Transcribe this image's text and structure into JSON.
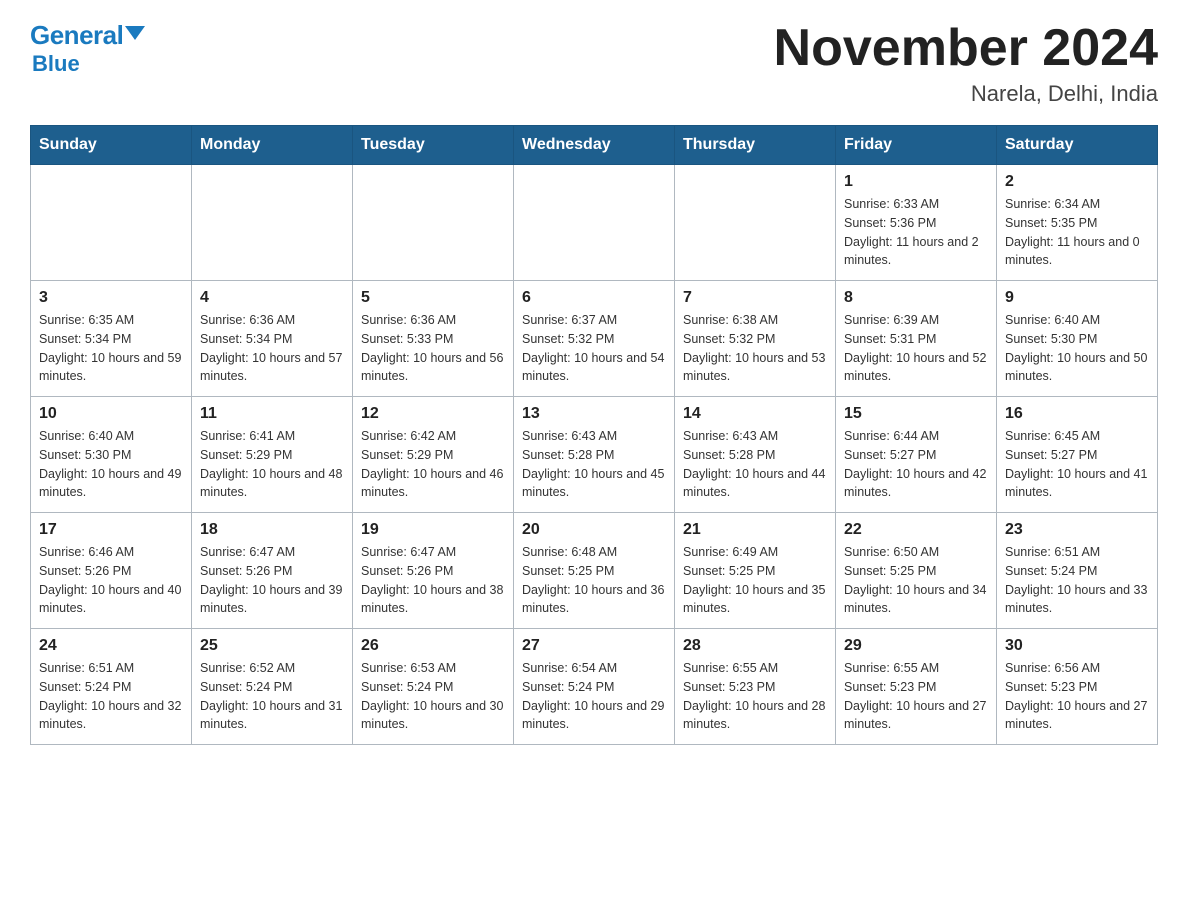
{
  "header": {
    "logo_general": "General",
    "logo_blue": "Blue",
    "month_title": "November 2024",
    "location": "Narela, Delhi, India"
  },
  "weekdays": [
    "Sunday",
    "Monday",
    "Tuesday",
    "Wednesday",
    "Thursday",
    "Friday",
    "Saturday"
  ],
  "weeks": [
    [
      {
        "day": "",
        "info": ""
      },
      {
        "day": "",
        "info": ""
      },
      {
        "day": "",
        "info": ""
      },
      {
        "day": "",
        "info": ""
      },
      {
        "day": "",
        "info": ""
      },
      {
        "day": "1",
        "info": "Sunrise: 6:33 AM\nSunset: 5:36 PM\nDaylight: 11 hours and 2 minutes."
      },
      {
        "day": "2",
        "info": "Sunrise: 6:34 AM\nSunset: 5:35 PM\nDaylight: 11 hours and 0 minutes."
      }
    ],
    [
      {
        "day": "3",
        "info": "Sunrise: 6:35 AM\nSunset: 5:34 PM\nDaylight: 10 hours and 59 minutes."
      },
      {
        "day": "4",
        "info": "Sunrise: 6:36 AM\nSunset: 5:34 PM\nDaylight: 10 hours and 57 minutes."
      },
      {
        "day": "5",
        "info": "Sunrise: 6:36 AM\nSunset: 5:33 PM\nDaylight: 10 hours and 56 minutes."
      },
      {
        "day": "6",
        "info": "Sunrise: 6:37 AM\nSunset: 5:32 PM\nDaylight: 10 hours and 54 minutes."
      },
      {
        "day": "7",
        "info": "Sunrise: 6:38 AM\nSunset: 5:32 PM\nDaylight: 10 hours and 53 minutes."
      },
      {
        "day": "8",
        "info": "Sunrise: 6:39 AM\nSunset: 5:31 PM\nDaylight: 10 hours and 52 minutes."
      },
      {
        "day": "9",
        "info": "Sunrise: 6:40 AM\nSunset: 5:30 PM\nDaylight: 10 hours and 50 minutes."
      }
    ],
    [
      {
        "day": "10",
        "info": "Sunrise: 6:40 AM\nSunset: 5:30 PM\nDaylight: 10 hours and 49 minutes."
      },
      {
        "day": "11",
        "info": "Sunrise: 6:41 AM\nSunset: 5:29 PM\nDaylight: 10 hours and 48 minutes."
      },
      {
        "day": "12",
        "info": "Sunrise: 6:42 AM\nSunset: 5:29 PM\nDaylight: 10 hours and 46 minutes."
      },
      {
        "day": "13",
        "info": "Sunrise: 6:43 AM\nSunset: 5:28 PM\nDaylight: 10 hours and 45 minutes."
      },
      {
        "day": "14",
        "info": "Sunrise: 6:43 AM\nSunset: 5:28 PM\nDaylight: 10 hours and 44 minutes."
      },
      {
        "day": "15",
        "info": "Sunrise: 6:44 AM\nSunset: 5:27 PM\nDaylight: 10 hours and 42 minutes."
      },
      {
        "day": "16",
        "info": "Sunrise: 6:45 AM\nSunset: 5:27 PM\nDaylight: 10 hours and 41 minutes."
      }
    ],
    [
      {
        "day": "17",
        "info": "Sunrise: 6:46 AM\nSunset: 5:26 PM\nDaylight: 10 hours and 40 minutes."
      },
      {
        "day": "18",
        "info": "Sunrise: 6:47 AM\nSunset: 5:26 PM\nDaylight: 10 hours and 39 minutes."
      },
      {
        "day": "19",
        "info": "Sunrise: 6:47 AM\nSunset: 5:26 PM\nDaylight: 10 hours and 38 minutes."
      },
      {
        "day": "20",
        "info": "Sunrise: 6:48 AM\nSunset: 5:25 PM\nDaylight: 10 hours and 36 minutes."
      },
      {
        "day": "21",
        "info": "Sunrise: 6:49 AM\nSunset: 5:25 PM\nDaylight: 10 hours and 35 minutes."
      },
      {
        "day": "22",
        "info": "Sunrise: 6:50 AM\nSunset: 5:25 PM\nDaylight: 10 hours and 34 minutes."
      },
      {
        "day": "23",
        "info": "Sunrise: 6:51 AM\nSunset: 5:24 PM\nDaylight: 10 hours and 33 minutes."
      }
    ],
    [
      {
        "day": "24",
        "info": "Sunrise: 6:51 AM\nSunset: 5:24 PM\nDaylight: 10 hours and 32 minutes."
      },
      {
        "day": "25",
        "info": "Sunrise: 6:52 AM\nSunset: 5:24 PM\nDaylight: 10 hours and 31 minutes."
      },
      {
        "day": "26",
        "info": "Sunrise: 6:53 AM\nSunset: 5:24 PM\nDaylight: 10 hours and 30 minutes."
      },
      {
        "day": "27",
        "info": "Sunrise: 6:54 AM\nSunset: 5:24 PM\nDaylight: 10 hours and 29 minutes."
      },
      {
        "day": "28",
        "info": "Sunrise: 6:55 AM\nSunset: 5:23 PM\nDaylight: 10 hours and 28 minutes."
      },
      {
        "day": "29",
        "info": "Sunrise: 6:55 AM\nSunset: 5:23 PM\nDaylight: 10 hours and 27 minutes."
      },
      {
        "day": "30",
        "info": "Sunrise: 6:56 AM\nSunset: 5:23 PM\nDaylight: 10 hours and 27 minutes."
      }
    ]
  ]
}
